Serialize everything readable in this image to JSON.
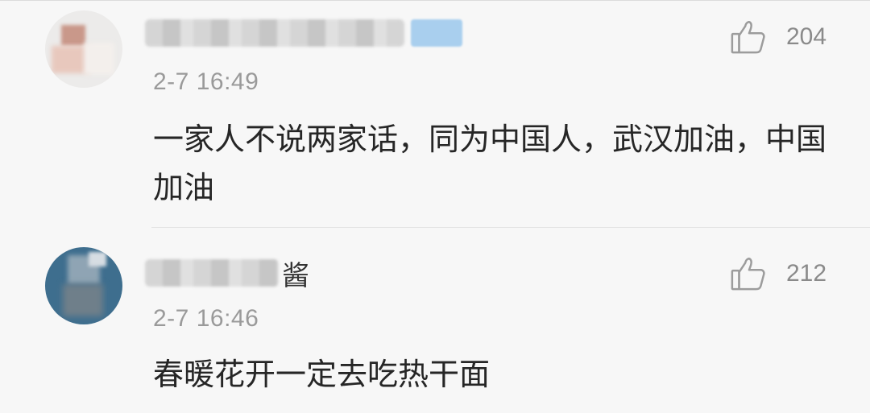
{
  "comments": [
    {
      "username_visible_suffix": "",
      "time": "2-7 16:49",
      "content": "一家人不说两家话，同为中国人，武汉加油，中国加油",
      "likes": "204",
      "avatar_color": "#ecebea",
      "has_vip_badge": true
    },
    {
      "username_visible_suffix": "酱",
      "time": "2-7 16:46",
      "content": "春暖花开一定去吃热干面",
      "likes": "212",
      "avatar_color": "#3e6e8e",
      "has_vip_badge": false
    }
  ],
  "icons": {
    "like": "thumbs-up-icon"
  },
  "colors": {
    "time": "#9a9a9a",
    "content": "#262626",
    "likes": "#8a8a8a",
    "vip_badge": "#a9cfee"
  }
}
